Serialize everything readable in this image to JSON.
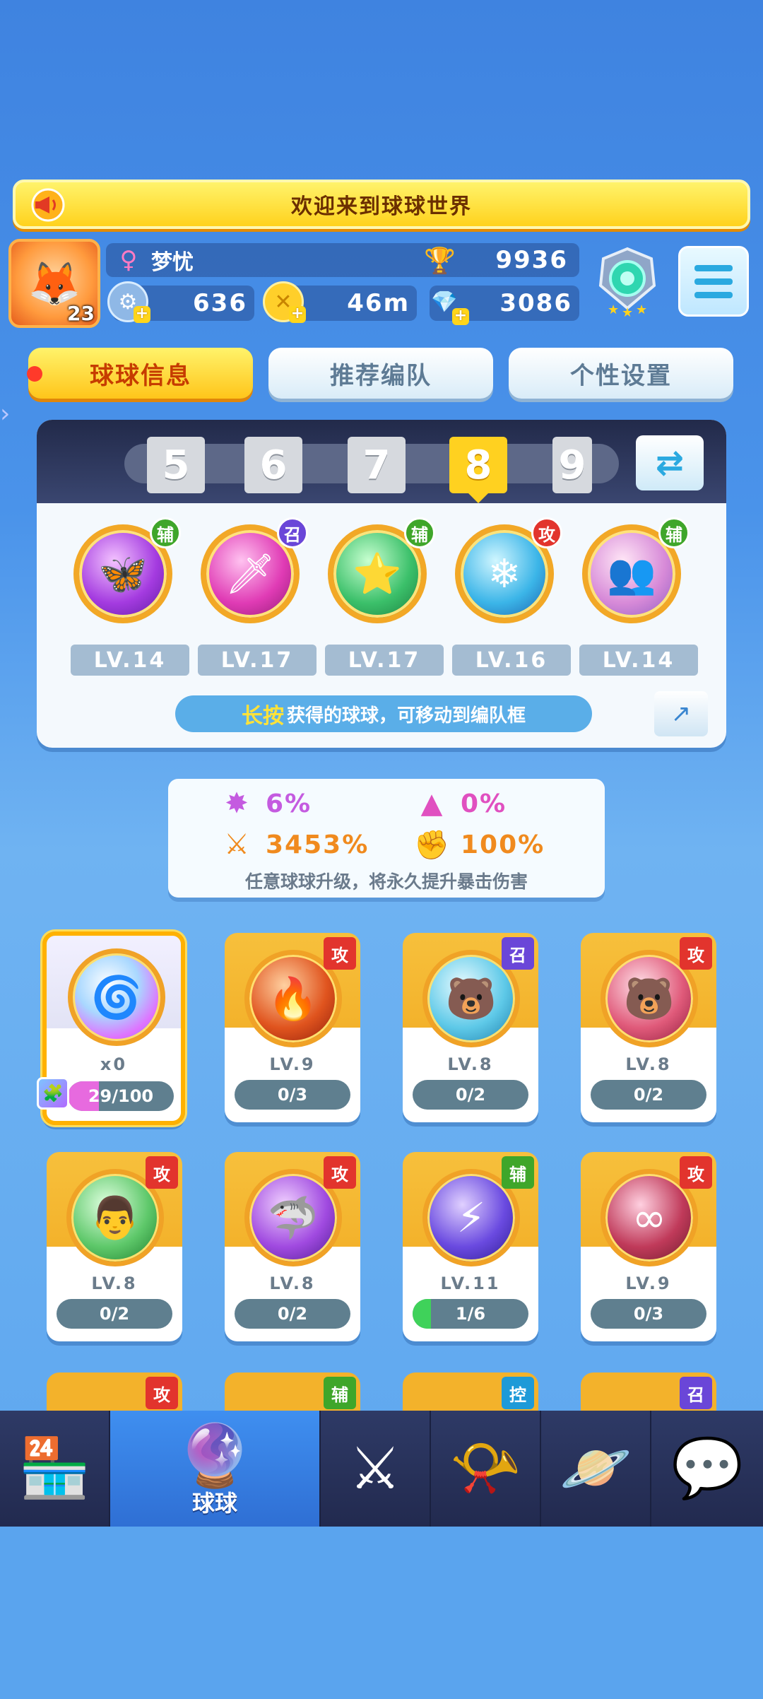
{
  "banner": {
    "text": "欢迎来到球球世界",
    "icon": "megaphone-icon"
  },
  "player": {
    "avatar_level": "23",
    "gender_icon": "female-icon",
    "name": "梦忧",
    "trophies": "9936",
    "resources": [
      {
        "name": "energy",
        "icon": "energy-icon",
        "value": "636"
      },
      {
        "name": "coin",
        "icon": "coin-icon",
        "value": "46m"
      },
      {
        "name": "diamond",
        "icon": "diamond-icon",
        "value": "3086"
      }
    ],
    "rank_icon": "rank-emblem-icon"
  },
  "tabs": [
    {
      "label": "球球信息",
      "active": true
    },
    {
      "label": "推荐编队",
      "active": false
    },
    {
      "label": "个性设置",
      "active": false
    }
  ],
  "team": {
    "slots": [
      "5",
      "6",
      "7",
      "8",
      "9"
    ],
    "active_slot": "8",
    "balls": [
      {
        "tag": "辅",
        "level": "LV.14",
        "icon": "butterfly-orb-icon"
      },
      {
        "tag": "召",
        "level": "LV.17",
        "icon": "sword-orb-icon"
      },
      {
        "tag": "辅",
        "level": "LV.17",
        "icon": "star-arrow-orb-icon"
      },
      {
        "tag": "攻",
        "level": "LV.16",
        "icon": "ice-orb-icon"
      },
      {
        "tag": "辅",
        "level": "LV.14",
        "icon": "figures-orb-icon"
      }
    ],
    "hint_highlight": "长按",
    "hint_text": "获得的球球，可移动到编队框"
  },
  "stats": {
    "items": [
      {
        "icon": "crit-rate-icon",
        "value": "6%",
        "color": "#c45be0"
      },
      {
        "icon": "boost-icon",
        "value": "0%",
        "color": "#e050c0"
      },
      {
        "icon": "crit-damage-icon",
        "value": "3453%",
        "color": "#f08a1e"
      },
      {
        "icon": "fist-icon",
        "value": "100%",
        "color": "#f08a1e"
      }
    ],
    "note": "任意球球升级，将永久提升暴击伤害"
  },
  "cards": [
    {
      "tag": "",
      "level": "x0",
      "progress": "29/100",
      "fill": 0.29,
      "icon": "rainbow-orb-icon",
      "special": true
    },
    {
      "tag": "攻",
      "level": "LV.9",
      "progress": "0/3",
      "fill": 0,
      "icon": "phoenix-orb-icon"
    },
    {
      "tag": "召",
      "level": "LV.8",
      "progress": "0/2",
      "fill": 0,
      "icon": "bear-orb-icon"
    },
    {
      "tag": "攻",
      "level": "LV.8",
      "progress": "0/2",
      "fill": 0,
      "icon": "red-bear-orb-icon"
    },
    {
      "tag": "攻",
      "level": "LV.8",
      "progress": "0/2",
      "fill": 0,
      "icon": "logger-orb-icon"
    },
    {
      "tag": "攻",
      "level": "LV.8",
      "progress": "0/2",
      "fill": 0,
      "icon": "shark-orb-icon"
    },
    {
      "tag": "辅",
      "level": "LV.11",
      "progress": "1/6",
      "fill": 0.16,
      "icon": "lightning-orb-icon"
    },
    {
      "tag": "攻",
      "level": "LV.9",
      "progress": "0/3",
      "fill": 0,
      "icon": "infinity-orb-icon"
    }
  ],
  "partial_cards": [
    {
      "tag": "攻"
    },
    {
      "tag": "辅"
    },
    {
      "tag": "控"
    },
    {
      "tag": "召"
    }
  ],
  "nav": [
    {
      "icon": "shop-icon",
      "label": ""
    },
    {
      "icon": "balls-icon",
      "label": "球球",
      "active": true
    },
    {
      "icon": "swords-icon",
      "label": ""
    },
    {
      "icon": "whistle-icon",
      "label": ""
    },
    {
      "icon": "planet-icon",
      "label": ""
    },
    {
      "icon": "chat-heart-icon",
      "label": ""
    }
  ]
}
